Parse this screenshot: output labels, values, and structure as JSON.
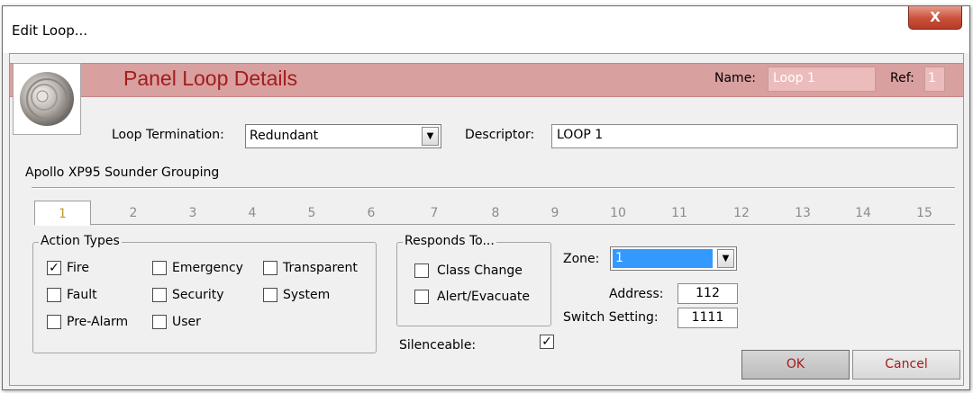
{
  "window": {
    "title": "Edit Loop...",
    "close_glyph": "X"
  },
  "header": {
    "title": "Panel Loop Details",
    "name_label": "Name:",
    "name_value": "Loop 1",
    "ref_label": "Ref:",
    "ref_value": "1"
  },
  "loop_termination": {
    "label": "Loop Termination:",
    "value": "Redundant"
  },
  "descriptor": {
    "label": "Descriptor:",
    "value": "LOOP 1"
  },
  "grouping_label": "Apollo XP95 Sounder Grouping",
  "tabs": [
    "1",
    "2",
    "3",
    "4",
    "5",
    "6",
    "7",
    "8",
    "9",
    "10",
    "11",
    "12",
    "13",
    "14",
    "15"
  ],
  "active_tab": "1",
  "action_types": {
    "title": "Action Types",
    "items": [
      {
        "label": "Fire",
        "checked": true
      },
      {
        "label": "Emergency",
        "checked": false
      },
      {
        "label": "Transparent",
        "checked": false
      },
      {
        "label": "Fault",
        "checked": false
      },
      {
        "label": "Security",
        "checked": false
      },
      {
        "label": "System",
        "checked": false
      },
      {
        "label": "Pre-Alarm",
        "checked": false
      },
      {
        "label": "User",
        "checked": false
      }
    ]
  },
  "responds_to": {
    "title": "Responds To...",
    "items": [
      {
        "label": "Class Change",
        "checked": false
      },
      {
        "label": "Alert/Evacuate",
        "checked": false
      }
    ]
  },
  "silenceable": {
    "label": "Silenceable:",
    "checked": true
  },
  "zone": {
    "label": "Zone:",
    "value": "1"
  },
  "address": {
    "label": "Address:",
    "value": "112"
  },
  "switch_setting": {
    "label": "Switch Setting:",
    "value": "1111"
  },
  "buttons": {
    "ok": "OK",
    "cancel": "Cancel"
  },
  "colors": {
    "header_band": "#d9a0a0",
    "header_title": "#a31c1c",
    "button_text": "#a8191a",
    "zone_selected": "#3399ff"
  }
}
